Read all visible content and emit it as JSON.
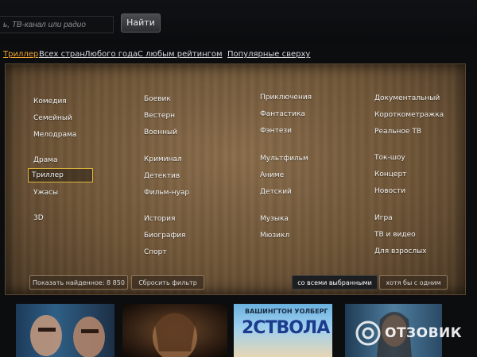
{
  "search": {
    "placeholder": "ь, ТВ-канал или радио",
    "button": "Найти"
  },
  "filters": [
    "Триллер",
    "Всех стран",
    "Любого года",
    "С любым рейтингом",
    "Популярные сверху"
  ],
  "genres": {
    "col1": [
      "Комедия",
      "Семейный",
      "Мелодрама",
      "Драма",
      "Триллер",
      "Ужасы",
      "3D"
    ],
    "col2": [
      "Боевик",
      "Вестерн",
      "Военный",
      "Криминал",
      "Детектив",
      "Фильм-нуар",
      "История",
      "Биография",
      "Спорт"
    ],
    "col3": [
      "Приключения",
      "Фантастика",
      "Фэнтези",
      "Мультфильм",
      "Аниме",
      "Детский",
      "Музыка",
      "Мюзикл"
    ],
    "col4": [
      "Документальный",
      "Короткометражка",
      "Реальное ТВ",
      "Ток-шоу",
      "Концерт",
      "Новости",
      "Игра",
      "ТВ и видео",
      "Для взрослых"
    ]
  },
  "actions": {
    "found": "Показать найденное: 8 850",
    "reset": "Сбросить фильтр",
    "match_all": "со всеми выбранными",
    "match_any": "хотя бы с одним"
  },
  "posters": {
    "names": "ВАШИНГТОН  УОЛБЕРГ",
    "title": "2СТВОЛА"
  },
  "watermark": "ОТЗОВИК",
  "colors": {
    "accent": "#f1a531",
    "selection_border": "#e1b93c"
  },
  "icons": [
    "search-submit",
    "watermark-logo-icon"
  ]
}
